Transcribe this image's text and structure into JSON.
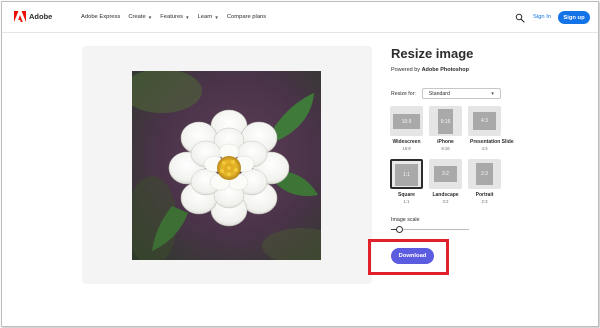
{
  "header": {
    "brand": "Adobe",
    "nav": [
      {
        "label": "Adobe Express",
        "has_menu": false
      },
      {
        "label": "Create",
        "has_menu": true
      },
      {
        "label": "Features",
        "has_menu": true
      },
      {
        "label": "Learn",
        "has_menu": true
      },
      {
        "label": "Compare plans",
        "has_menu": false
      }
    ],
    "search_icon": "search-icon",
    "sign_in": "Sign In",
    "sign_up": "Sign up"
  },
  "editor": {
    "image_description_icon": "white-flower-photo"
  },
  "panel": {
    "title": "Resize image",
    "powered_prefix": "Powered by ",
    "powered_brand": "Adobe Photoshop",
    "resize_for_label": "Resize for:",
    "resize_for_value": "Standard",
    "options": [
      {
        "tile": "16:9",
        "name": "Widescreen",
        "ratio": "16:9",
        "selected": false
      },
      {
        "tile": "9:16",
        "name": "iPhone",
        "ratio": "9:16",
        "selected": false
      },
      {
        "tile": "4:3",
        "name": "Presentation Slide",
        "ratio": "4:3",
        "selected": false
      },
      {
        "tile": "1:1",
        "name": "Square",
        "ratio": "1:1",
        "selected": true
      },
      {
        "tile": "3:2",
        "name": "Landscape",
        "ratio": "3:2",
        "selected": false
      },
      {
        "tile": "2:3",
        "name": "Portrait",
        "ratio": "2:3",
        "selected": false
      }
    ],
    "scale_label": "Image scale",
    "scale_value": 0.1,
    "download": "Download"
  },
  "colors": {
    "brand_red": "#eb1000",
    "link_blue": "#1473e6",
    "download_purple": "#5c5ce0",
    "highlight_red": "#e0202a"
  }
}
